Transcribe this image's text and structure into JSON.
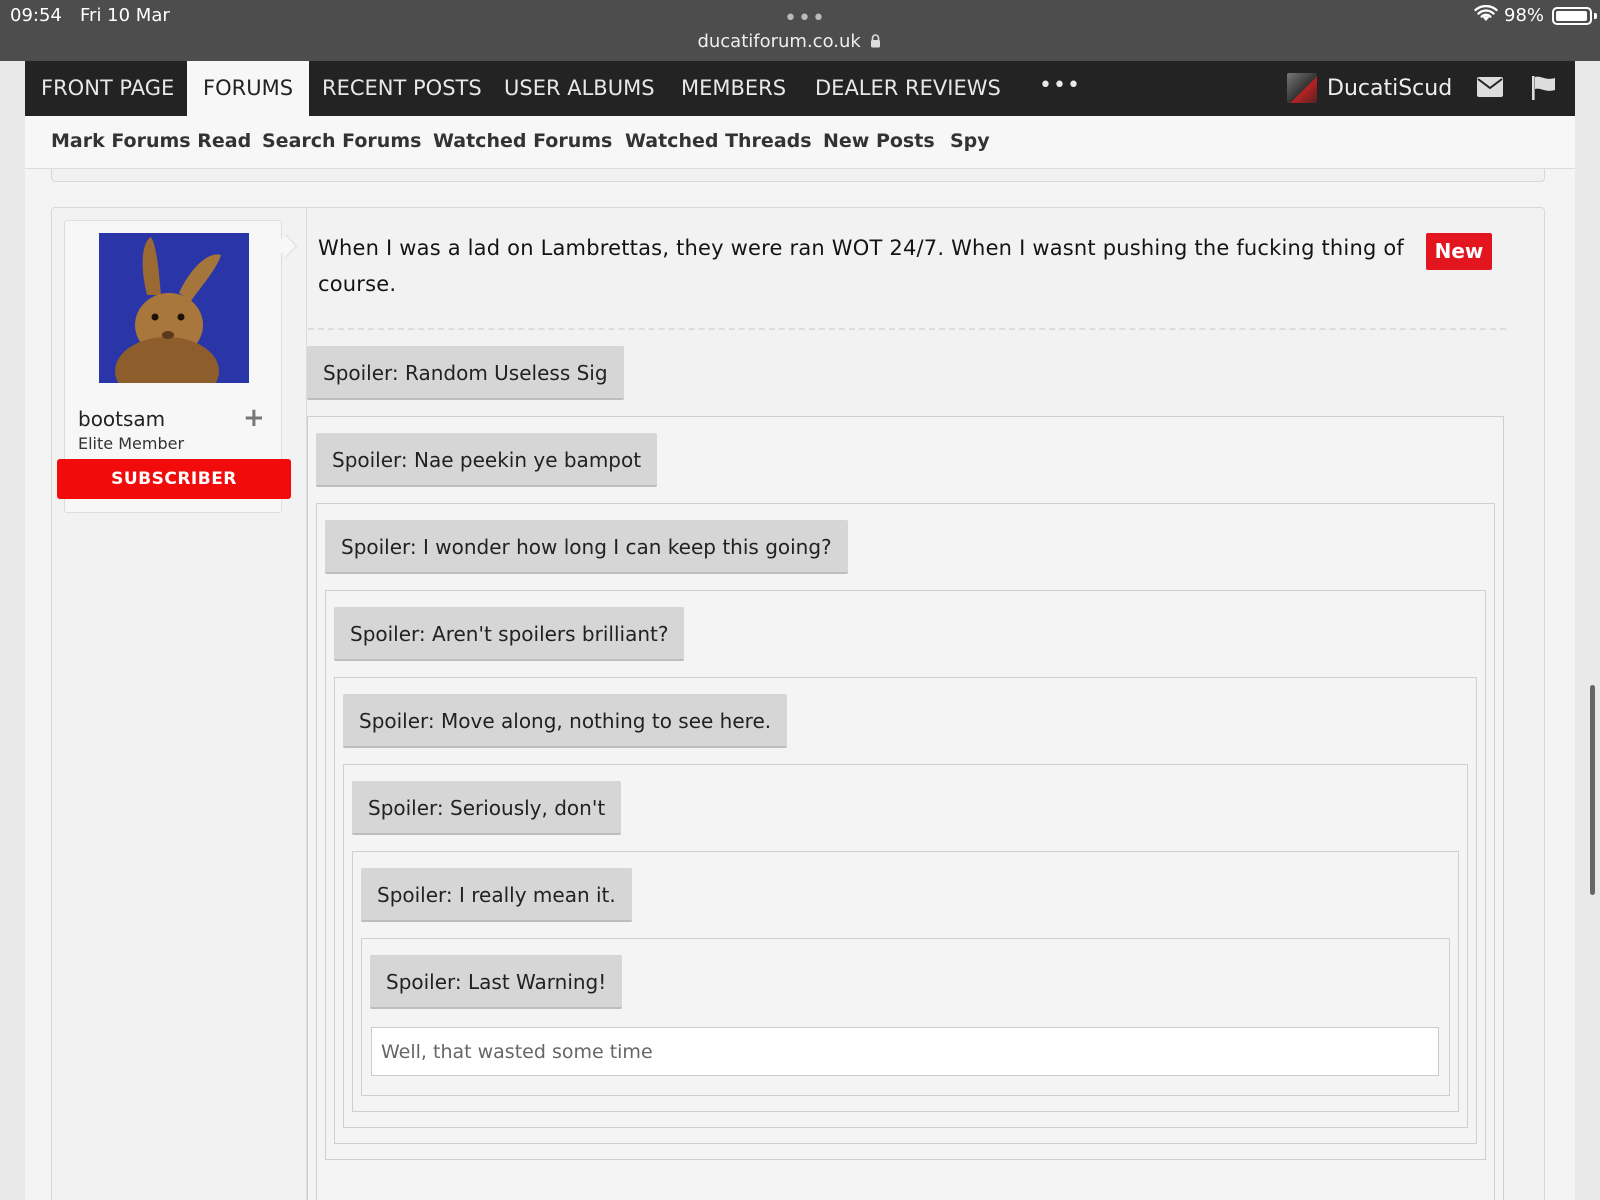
{
  "status_bar": {
    "time": "09:54",
    "date": "Fri 10 Mar",
    "url": "ducatiforum.co.uk",
    "battery": "98%",
    "battery_level": 0.98
  },
  "main_nav": {
    "tabs": [
      {
        "label": "FRONT PAGE",
        "active": false
      },
      {
        "label": "FORUMS",
        "active": true
      },
      {
        "label": "RECENT POSTS",
        "active": false
      },
      {
        "label": "USER ALBUMS",
        "active": false
      },
      {
        "label": "MEMBERS",
        "active": false
      },
      {
        "label": "DEALER REVIEWS",
        "active": false
      }
    ],
    "more": "•••",
    "username": "DucatiScud",
    "icons": [
      "mail-icon",
      "flag-icon"
    ]
  },
  "sub_nav": {
    "items": [
      "Mark Forums Read",
      "Search Forums",
      "Watched Forums",
      "Watched Threads",
      "New Posts",
      "Spy"
    ]
  },
  "post": {
    "user": {
      "name": "bootsam",
      "title": "Elite Member",
      "banner": "SUBSCRIBER",
      "follow": "+"
    },
    "message": "When I was a lad on Lambrettas, they were ran WOT 24/7. When I wasnt pushing the fucking thing of course.",
    "badge": "New",
    "spoilers": [
      "Spoiler: Random Useless Sig",
      "Spoiler: Nae peekin ye bampot",
      "Spoiler: I wonder how long I can keep this going?",
      "Spoiler: Aren't spoilers brilliant?",
      "Spoiler: Move along, nothing to see here.",
      "Spoiler: Seriously, don't",
      "Spoiler: I really mean it.",
      "Spoiler: Last Warning!"
    ],
    "final_text": "Well, that wasted some time"
  },
  "colors": {
    "nav_bg": "#232323",
    "subscriber_red": "#f20b0b",
    "new_badge_red": "#e3161f",
    "spoiler_button": "#d6d6d6"
  }
}
